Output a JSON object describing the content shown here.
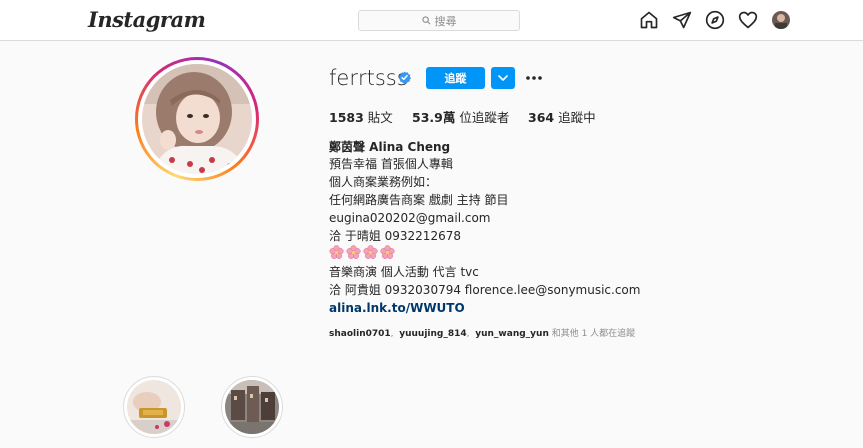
{
  "topbar": {
    "logo": "Instagram",
    "search_placeholder": "搜尋",
    "nav_icons": [
      "home-icon",
      "direct-icon",
      "explore-icon",
      "heart-icon",
      "profile-avatar"
    ]
  },
  "profile": {
    "username": "ferrtsss",
    "verified": true,
    "follow_label": "追蹤",
    "stats": {
      "posts_count": "1583",
      "posts_label": "貼文",
      "followers_count": "53.9萬",
      "followers_label": "位追蹤者",
      "following_count": "364",
      "following_label": "追蹤中"
    },
    "bio": {
      "name": "鄭茵聲 Alina Cheng",
      "lines": [
        "預告幸福 首張個人專輯",
        "個人商案業務例如：",
        "任何網路廣告商案 戲劇 主持 節目",
        "eugina020202@gmail.com",
        "洽 于晴姐 0932212678",
        "🌸🌸🌸🌸",
        "音樂商演 個人活動 代言 tvc",
        "洽 阿貴姐 0932030794 florence.lee@sonymusic.com"
      ],
      "link": "alina.lnk.to/WWUTO"
    },
    "followed_by": {
      "users": [
        "shaolin0701",
        "yuuujing_814",
        "yun_wang_yun"
      ],
      "suffix": "和其他 1 人都在追蹤"
    }
  },
  "highlights": [
    {
      "label": ""
    },
    {
      "label": ""
    }
  ],
  "colors": {
    "accent": "#0095f6",
    "link": "#00376b",
    "border": "#dbdbdb",
    "background": "#fafafa"
  }
}
